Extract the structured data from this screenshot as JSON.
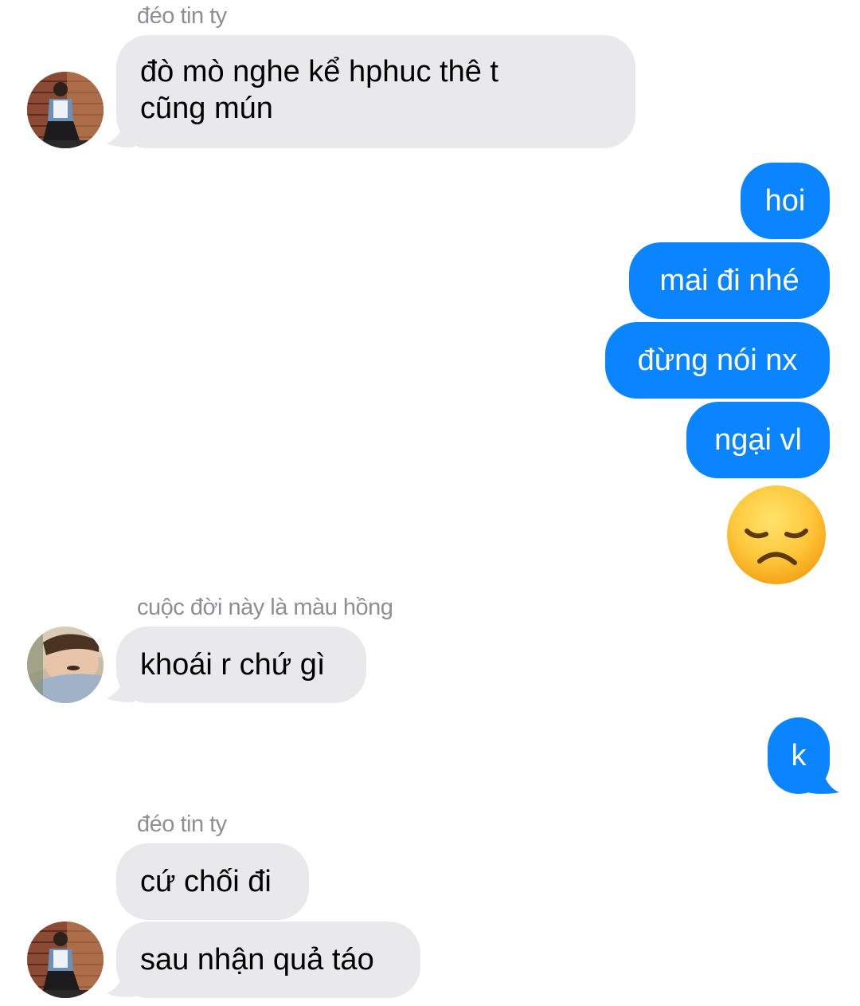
{
  "conversation": {
    "group1": {
      "sender": "đéo tin ty",
      "message": "đò mò nghe kể hphuc thê t\ncũng mún"
    },
    "outgoing1": {
      "messages": [
        "hoi",
        "mai đi nhé",
        "đừng nói nx",
        "ngại vl"
      ],
      "emoji": "disappointed-face-emoji"
    },
    "group2": {
      "sender": "cuộc đời này là màu hồng",
      "message": "khoái r chứ gì"
    },
    "outgoing2": {
      "message": "k"
    },
    "group3": {
      "sender": "đéo tin ty",
      "messages": [
        "cứ chối đi",
        "sau nhận quả táo"
      ]
    }
  },
  "colors": {
    "incoming_bubble": "#e9e9eb",
    "outgoing_bubble": "#0a84ff",
    "sender_name": "#8e8e93",
    "emoji_face": "#ffc83d"
  }
}
